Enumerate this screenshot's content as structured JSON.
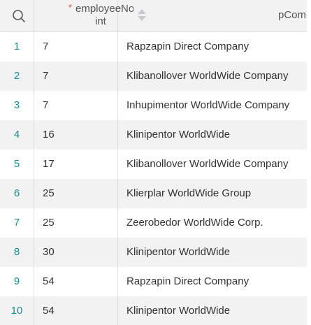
{
  "header": {
    "required_marker": "*",
    "columns": [
      {
        "name": "employeeNo",
        "type": "int"
      },
      {
        "name": "pCompanyName",
        "type": ""
      }
    ]
  },
  "rows": [
    {
      "num": "1",
      "employeeNo": "7",
      "pCompanyName": "Rapzapin Direct Company"
    },
    {
      "num": "2",
      "employeeNo": "7",
      "pCompanyName": "Klibanollover WorldWide Company"
    },
    {
      "num": "3",
      "employeeNo": "7",
      "pCompanyName": "Inhupimentor WorldWide Company"
    },
    {
      "num": "4",
      "employeeNo": "16",
      "pCompanyName": "Klinipentor WorldWide"
    },
    {
      "num": "5",
      "employeeNo": "17",
      "pCompanyName": "Klibanollover WorldWide Company"
    },
    {
      "num": "6",
      "employeeNo": "25",
      "pCompanyName": "Klierplar WorldWide Group"
    },
    {
      "num": "7",
      "employeeNo": "25",
      "pCompanyName": "Zeerobedor WorldWide Corp."
    },
    {
      "num": "8",
      "employeeNo": "30",
      "pCompanyName": "Klinipentor WorldWide"
    },
    {
      "num": "9",
      "employeeNo": "54",
      "pCompanyName": "Rapzapin Direct Company"
    },
    {
      "num": "10",
      "employeeNo": "54",
      "pCompanyName": "Klinipentor WorldWide"
    }
  ],
  "colors": {
    "row_number": "#1a8f8f",
    "required_marker": "#d9534f",
    "header_bg": "#f2f2f2",
    "alt_row_bg": "#f2f2f2"
  }
}
